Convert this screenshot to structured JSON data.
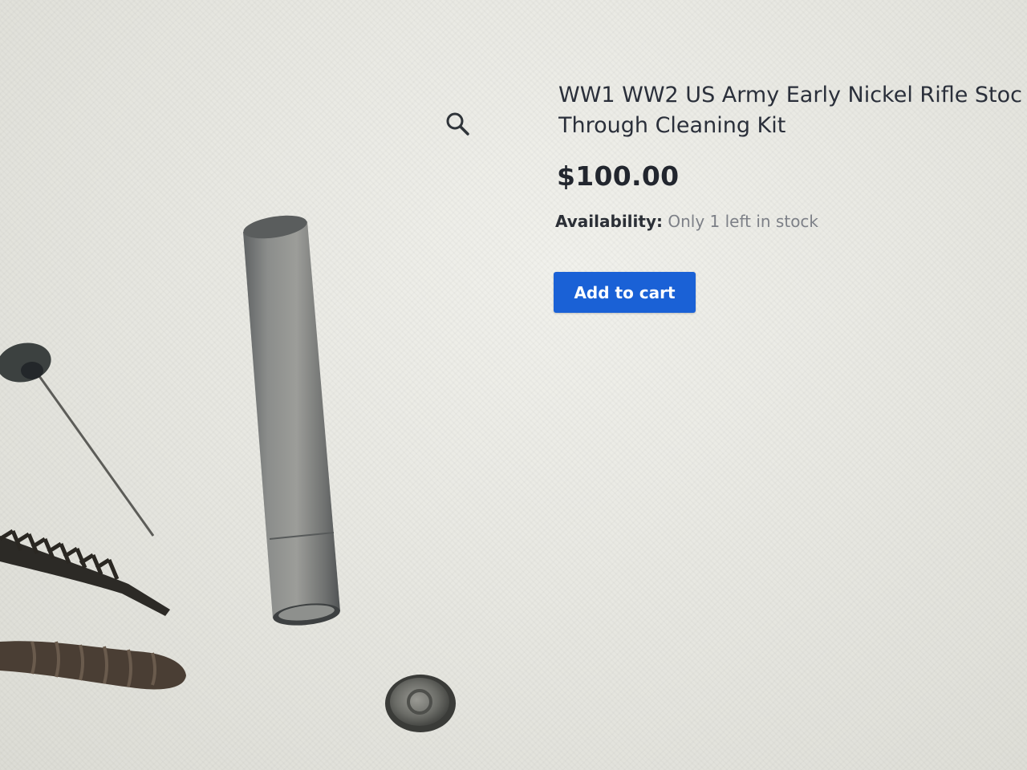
{
  "product": {
    "title_line1": "WW1 WW2 US Army Early Nickel Rifle Stoc",
    "title_line2": "Through Cleaning Kit",
    "price": "$100.00",
    "availability_label": "Availability:",
    "availability_value": "Only 1 left in stock",
    "add_to_cart_label": "Add to cart"
  },
  "icons": {
    "zoom": "magnifier-icon"
  },
  "colors": {
    "button_bg": "#1a61d6",
    "button_text": "#ffffff",
    "availability_value": "#7d8087"
  }
}
